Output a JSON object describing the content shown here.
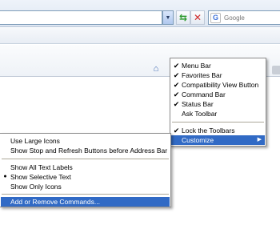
{
  "toolbar": {
    "search_placeholder": "Google",
    "search_engine_icon": "G",
    "address_dropdown_glyph": "▼",
    "refresh_glyph": "⇆",
    "stop_glyph": "✕"
  },
  "context_menu": {
    "items": [
      {
        "label": "Menu Bar",
        "checked": true
      },
      {
        "label": "Favorites Bar",
        "checked": true
      },
      {
        "label": "Compatibility View Button",
        "checked": true
      },
      {
        "label": "Command Bar",
        "checked": true
      },
      {
        "label": "Status Bar",
        "checked": true
      },
      {
        "label": "Ask Toolbar",
        "checked": false
      },
      {
        "label": "Lock the Toolbars",
        "checked": true
      },
      {
        "label": "Customize",
        "checked": false,
        "submenu_arrow": "▶"
      }
    ],
    "check_glyph": "✔"
  },
  "customize_menu": {
    "items": [
      {
        "label": "Use Large Icons"
      },
      {
        "label": "Show Stop and Refresh Buttons before Address Bar"
      },
      {
        "label": "Show All Text Labels"
      },
      {
        "label": "Show Selective Text",
        "selected": true
      },
      {
        "label": "Show Only Icons"
      },
      {
        "label": "Add or Remove Commands..."
      }
    ],
    "radio_glyph": "●"
  },
  "colors": {
    "highlight": "#316ac5",
    "chrome": "#dde6f2"
  }
}
